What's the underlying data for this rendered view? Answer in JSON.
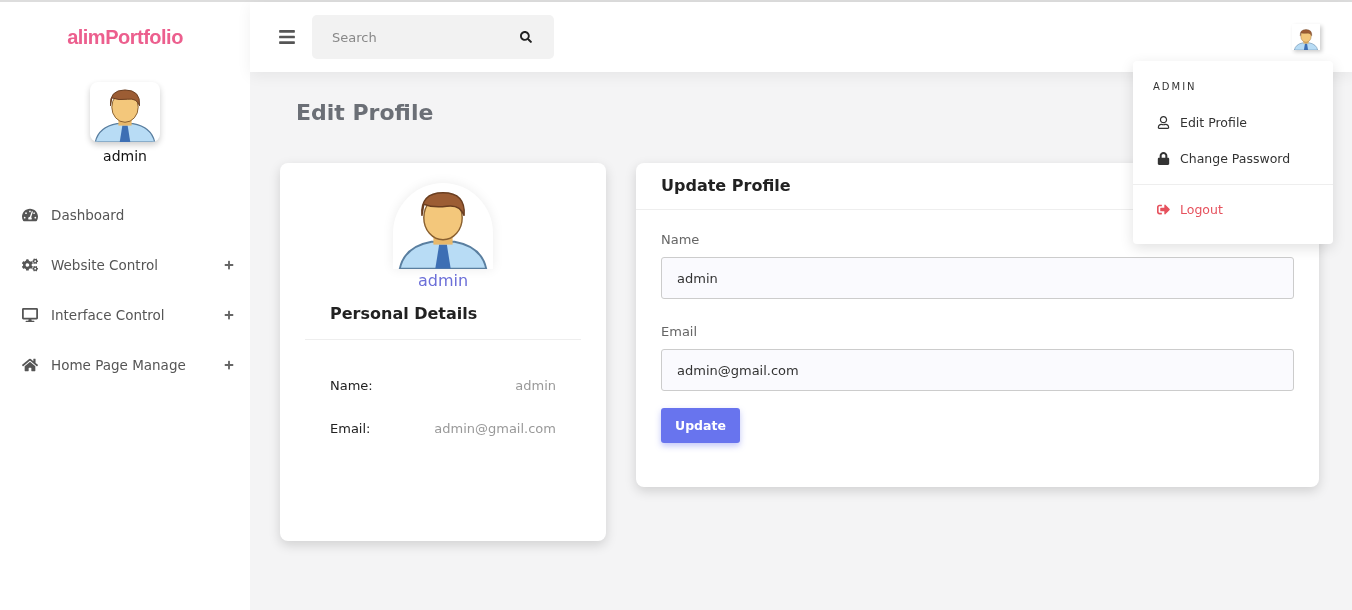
{
  "brand": "alimPortfolio",
  "sidebar": {
    "user": "admin",
    "items": [
      {
        "label": "Dashboard",
        "kind": "dashboard",
        "expandable": false
      },
      {
        "label": "Website Control",
        "kind": "cogs",
        "expandable": true
      },
      {
        "label": "Interface Control",
        "kind": "desktop",
        "expandable": true
      },
      {
        "label": "Home Page Manage",
        "kind": "home",
        "expandable": true
      }
    ]
  },
  "search": {
    "placeholder": "Search"
  },
  "user_menu": {
    "heading": "ADMIN",
    "items": [
      {
        "label": "Edit Profile",
        "kind": "user"
      },
      {
        "label": "Change Password",
        "kind": "lock"
      },
      {
        "label": "Logout",
        "kind": "logout"
      }
    ]
  },
  "page_title": "Edit Profile",
  "profile_card": {
    "name": "admin",
    "heading": "Personal Details",
    "details": [
      {
        "label": "Name:",
        "value": "admin"
      },
      {
        "label": "Email:",
        "value": "admin@gmail.com"
      }
    ]
  },
  "update_form": {
    "title": "Update Profile",
    "fields": [
      {
        "label": "Name",
        "value": "admin"
      },
      {
        "label": "Email",
        "value": "admin@gmail.com"
      }
    ],
    "button": "Update"
  }
}
